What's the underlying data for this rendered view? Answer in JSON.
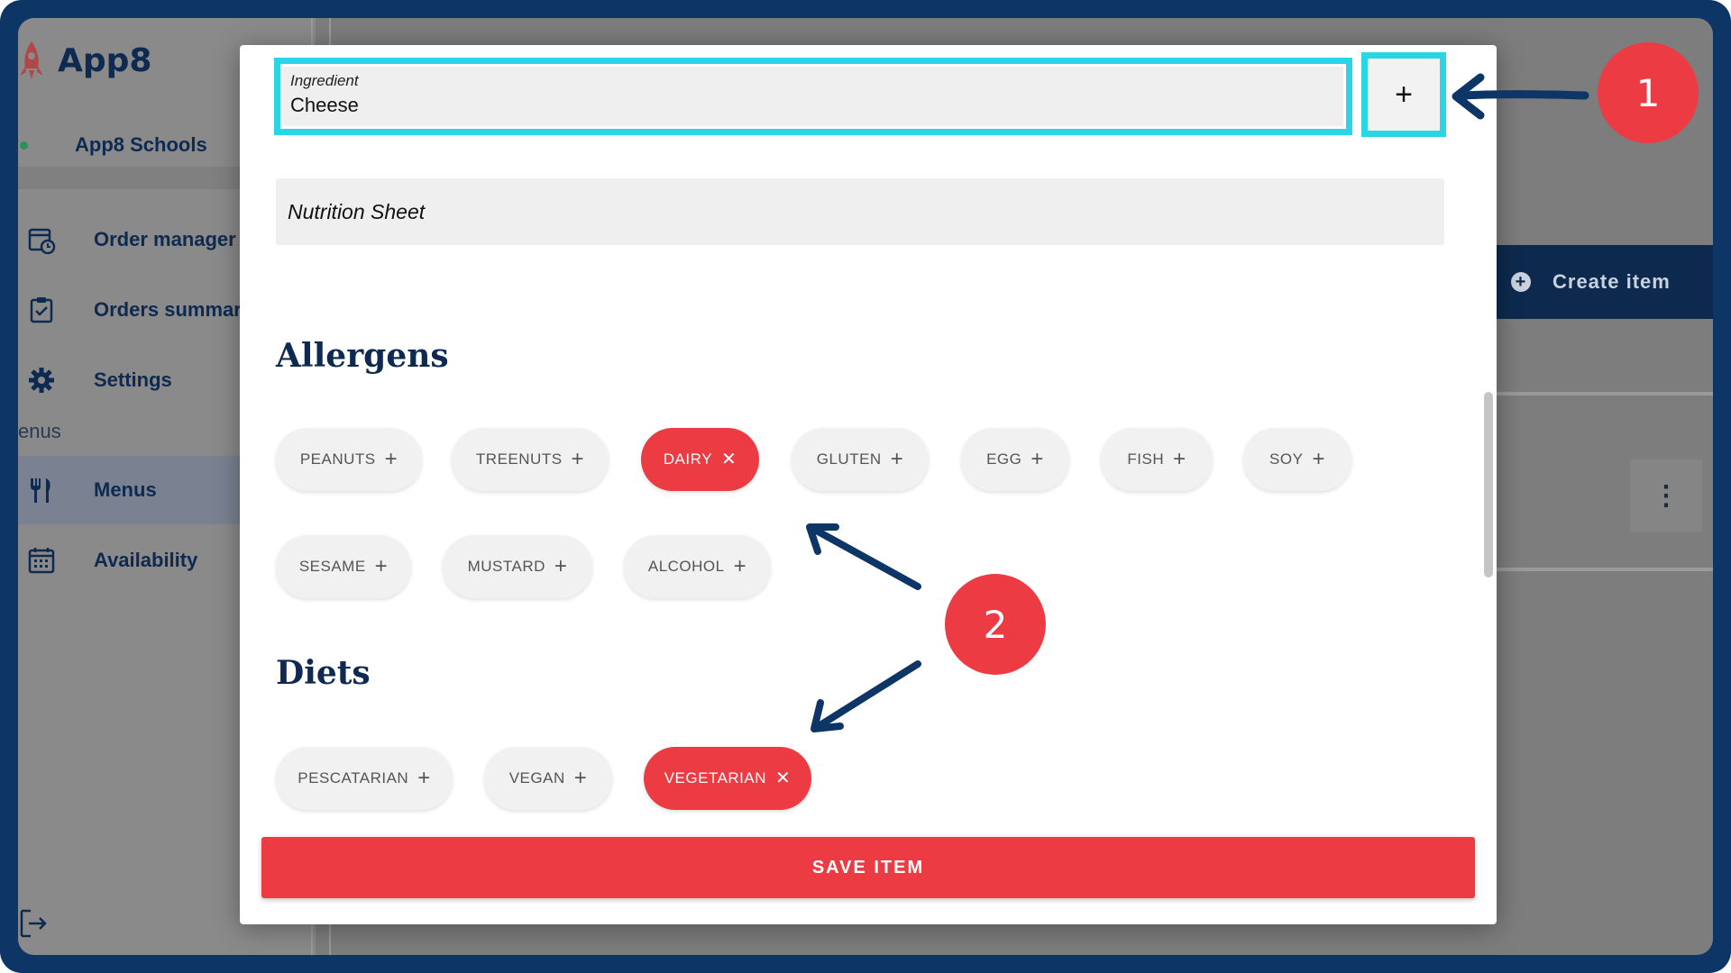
{
  "app": {
    "logo_text": "App8",
    "org_name": "App8 Schools",
    "nav": [
      {
        "label": "Order manager",
        "icon": "calendar-clock-icon"
      },
      {
        "label": "Orders summary",
        "icon": "clipboard-check-icon"
      },
      {
        "label": "Settings",
        "icon": "gear-icon"
      },
      {
        "label": "Menus",
        "icon": "fork-knife-icon",
        "active": true
      },
      {
        "label": "Availability",
        "icon": "calendar-icon"
      }
    ],
    "section_label": "enus",
    "create_item_label": "Create item",
    "kebab_symbol": "⋮"
  },
  "modal": {
    "ingredient": {
      "label": "Ingredient",
      "value": "Cheese",
      "add_symbol": "+"
    },
    "nutrition_label": "Nutrition Sheet",
    "allergens_title": "Allergens",
    "allergens": [
      {
        "label": "PEANUTS",
        "selected": false,
        "symbol": "+"
      },
      {
        "label": "TREENUTS",
        "selected": false,
        "symbol": "+"
      },
      {
        "label": "DAIRY",
        "selected": true,
        "symbol": "✕"
      },
      {
        "label": "GLUTEN",
        "selected": false,
        "symbol": "+"
      },
      {
        "label": "EGG",
        "selected": false,
        "symbol": "+"
      },
      {
        "label": "FISH",
        "selected": false,
        "symbol": "+"
      },
      {
        "label": "SOY",
        "selected": false,
        "symbol": "+"
      },
      {
        "label": "SESAME",
        "selected": false,
        "symbol": "+"
      },
      {
        "label": "MUSTARD",
        "selected": false,
        "symbol": "+"
      },
      {
        "label": "ALCOHOL",
        "selected": false,
        "symbol": "+"
      }
    ],
    "diets_title": "Diets",
    "diets": [
      {
        "label": "PESCATARIAN",
        "selected": false,
        "symbol": "+"
      },
      {
        "label": "VEGAN",
        "selected": false,
        "symbol": "+"
      },
      {
        "label": "VEGETARIAN",
        "selected": true,
        "symbol": "✕"
      }
    ],
    "save_label": "SAVE ITEM"
  },
  "annotations": {
    "badge1": "1",
    "badge2": "2"
  },
  "colors": {
    "frame": "#0d3566",
    "accent_red": "#ec3b42",
    "highlight_cyan": "#2ad5e6",
    "navy_text": "#0e2a50"
  }
}
